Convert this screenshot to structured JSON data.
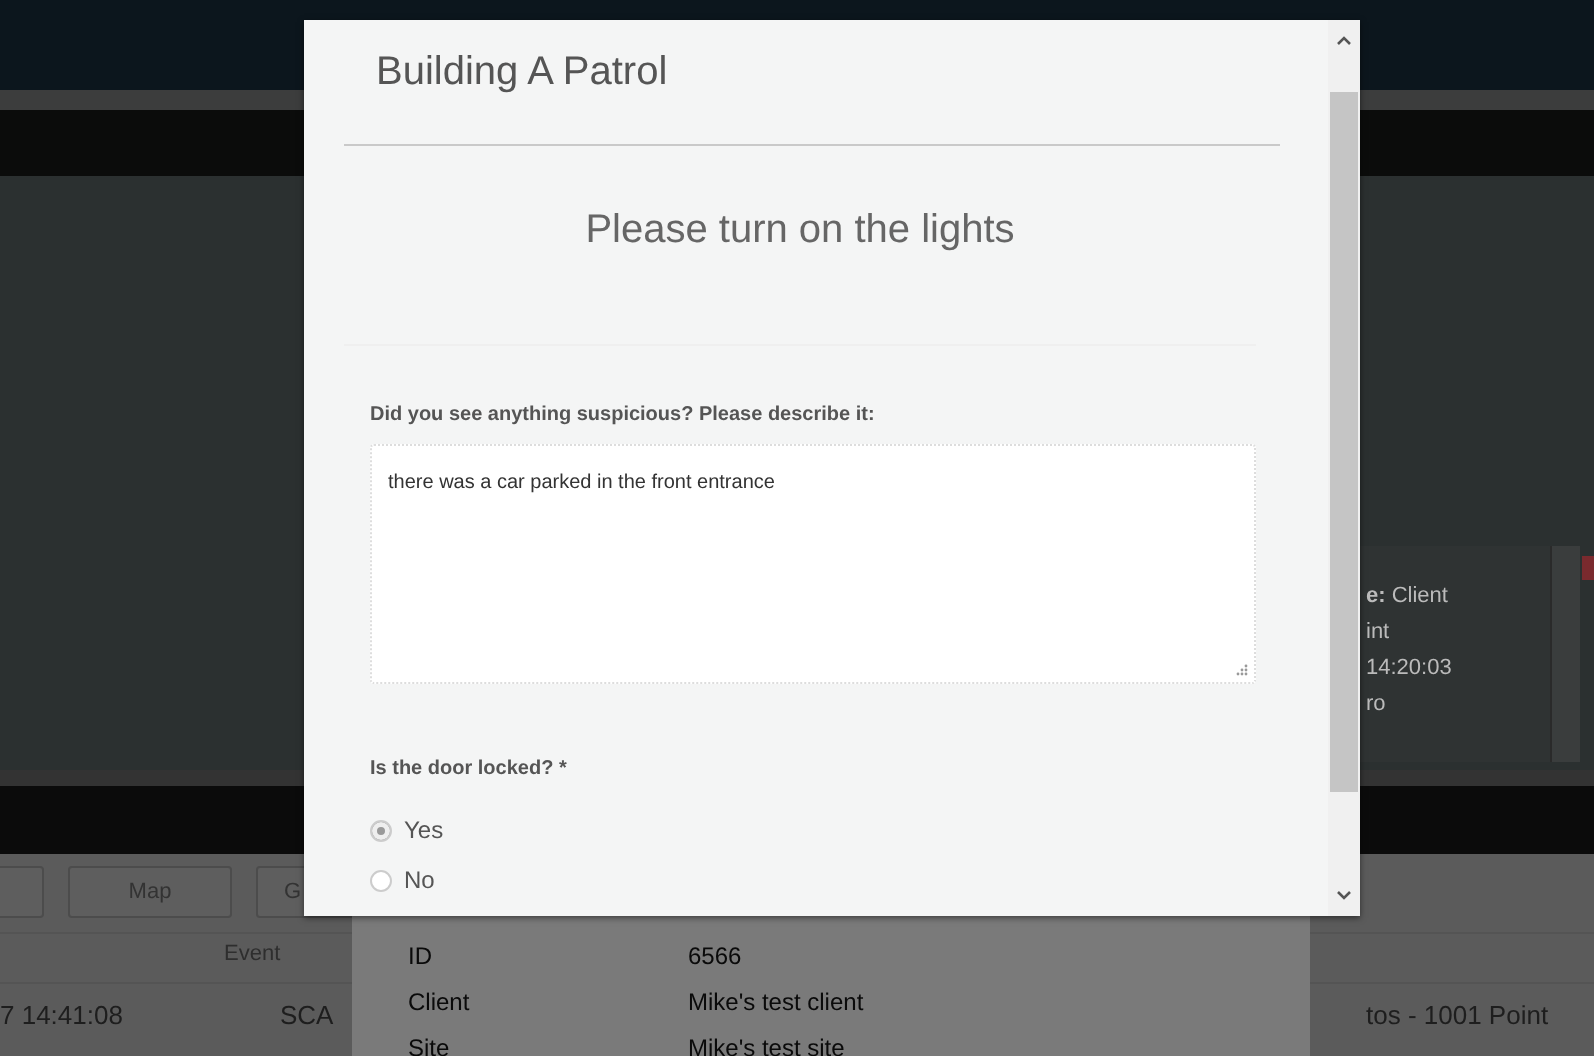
{
  "background": {
    "toolbar_buttons": [
      "Map",
      "G"
    ],
    "table": {
      "header": "Event",
      "cells": [
        "7 14:41:08",
        "SCA",
        "tos - 1001 Point"
      ]
    },
    "side_panel": {
      "lines": [
        "**e:** Client",
        "int",
        "14:20:03",
        "ro"
      ]
    }
  },
  "detail_dialog": {
    "rows": [
      {
        "label": "ID",
        "value": "6566"
      },
      {
        "label": "Client",
        "value": "Mike's test client"
      },
      {
        "label": "Site",
        "value": "Mike's test site"
      }
    ]
  },
  "modal": {
    "title": "Building A Patrol",
    "instruction": "Please turn on the lights",
    "questions": [
      {
        "kind": "text",
        "label": "Did you see anything suspicious? Please describe it:",
        "value": "there was a car parked in the front entrance"
      },
      {
        "kind": "radio",
        "label": "Is the door locked? *",
        "options": [
          {
            "label": "Yes",
            "selected": true
          },
          {
            "label": "No",
            "selected": false
          }
        ]
      }
    ]
  }
}
